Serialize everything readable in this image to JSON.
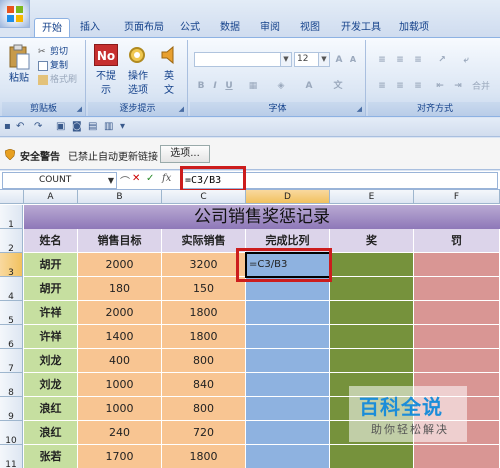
{
  "tabs": [
    "开始",
    "插入",
    "页面布局",
    "公式",
    "数据",
    "审阅",
    "视图",
    "开发工具",
    "加载项"
  ],
  "clipboard": {
    "paste": "粘贴",
    "cut": "剪切",
    "copy": "复制",
    "format_painter": "格式刷",
    "label": "剪贴板"
  },
  "step_tips": {
    "no_tip": "不提\n示",
    "op_tip": "操作\n选项",
    "english": "英\n文",
    "label": "逐步提示"
  },
  "font_group": {
    "size": "12",
    "label": "字体"
  },
  "align_group": {
    "label": "对齐方式",
    "merge": "合并"
  },
  "security": {
    "warning": "安全警告",
    "message": "已禁止自动更新链接",
    "options": "选项..."
  },
  "formula_bar": {
    "name_box": "COUNT",
    "formula": "=C3/B3"
  },
  "columns": [
    "A",
    "B",
    "C",
    "D",
    "E",
    "F"
  ],
  "rows": [
    "1",
    "2",
    "3",
    "4",
    "5",
    "6",
    "7",
    "8",
    "9",
    "10",
    "11"
  ],
  "sheet": {
    "title": "公司销售奖惩记录",
    "headers": [
      "姓名",
      "销售目标",
      "实际销售",
      "完成比列",
      "奖",
      "罚"
    ],
    "data": [
      [
        "胡开",
        "2000",
        "3200",
        "=C3/B3"
      ],
      [
        "胡开",
        "180",
        "150",
        ""
      ],
      [
        "许祥",
        "2000",
        "1800",
        ""
      ],
      [
        "许祥",
        "1400",
        "1800",
        ""
      ],
      [
        "刘龙",
        "400",
        "800",
        ""
      ],
      [
        "刘龙",
        "1000",
        "840",
        ""
      ],
      [
        "浪红",
        "1000",
        "800",
        ""
      ],
      [
        "浪红",
        "240",
        "720",
        ""
      ],
      [
        "张若",
        "1700",
        "1800",
        ""
      ]
    ]
  },
  "watermark": {
    "main": "百科全说",
    "sub": "助你轻松解决"
  },
  "colors": {
    "ribbon_text": "#15428b",
    "highlight_red": "#cc1d1d",
    "brand_blue": "#1b8dd9"
  }
}
